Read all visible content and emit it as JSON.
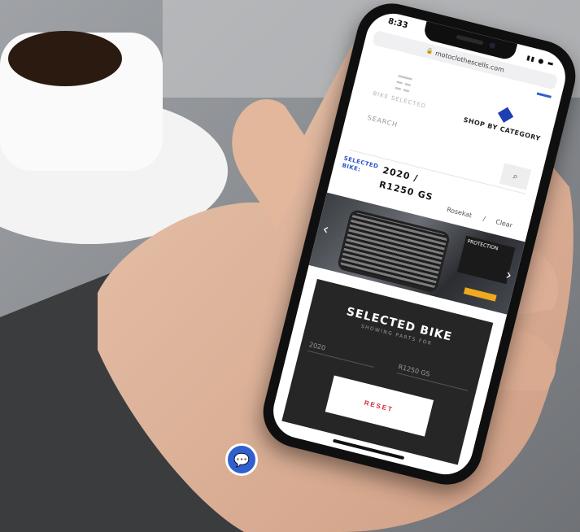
{
  "phone": {
    "status_time": "8:33",
    "status_icons": "▮▮ ● ▬",
    "url": "motoclothescells.com",
    "lock_icon": "🔒"
  },
  "header": {
    "bike_selected_label": "BIKE SELECTED",
    "shop_by_category_label": "SHOP BY CATEGORY",
    "bike_selected_icon": "☶",
    "shop_category_icon": "◆"
  },
  "search": {
    "label": "SEARCH",
    "button_icon": "⌕"
  },
  "selected_bike_row": {
    "label": "SELECTED BIKE:",
    "value_year": "2020 /",
    "value_model": "R1250 GS",
    "tab_one": "Rosekat",
    "separator": "/",
    "tab_two": "Clear"
  },
  "carousel": {
    "promo_text": "PROTECTION",
    "prev_icon": "‹",
    "next_icon": "›"
  },
  "selected_panel": {
    "title": "SELECTED BIKE",
    "subtitle": "SHOWING PARTS FOR",
    "year": "2020",
    "model": "R1250 GS",
    "reset_label": "RESET"
  },
  "chat": {
    "icon": "💬"
  },
  "colors": {
    "brand_blue": "#2f5fd0",
    "panel_dark": "#262626",
    "reset_red": "#d2233a"
  }
}
